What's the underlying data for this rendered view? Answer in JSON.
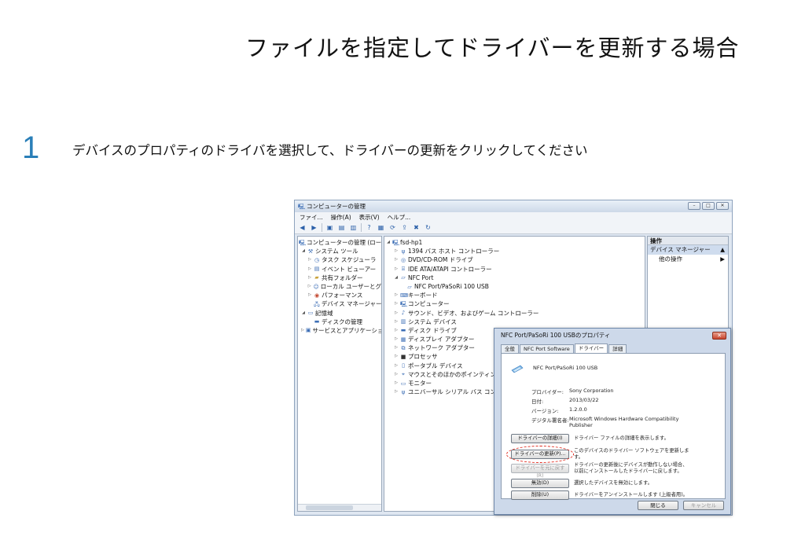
{
  "header": {
    "title": "ファイルを指定してドライバーを更新する場合"
  },
  "step": {
    "number": "1",
    "text": "デバイスのプロパティのドライバを選択して、ドライバーの更新をクリックしてください"
  },
  "cm": {
    "title": "コンピューターの管理",
    "menu": [
      "ファイ...",
      "操作(A)",
      "表示(V)",
      "ヘルプ..."
    ],
    "left_tree": [
      "コンピューターの管理 (ロー",
      "システム ツール",
      "タスク スケジューラ",
      "イベント ビューアー",
      "共有フォルダー",
      "ローカル ユーザーとグ",
      "パフォーマンス",
      "デバイス マネージャー",
      "記憶域",
      "ディスクの管理",
      "サービスとアプリケーショ"
    ],
    "mid_tree": [
      "fsd-hp1",
      "1394 バス ホスト コントローラー",
      "DVD/CD-ROM ドライブ",
      "IDE ATA/ATAPI コントローラー",
      "NFC Port",
      "NFC Port/PaSoRi 100 USB",
      "キーボード",
      "コンピューター",
      "サウンド、ビデオ、およびゲーム コントローラー",
      "システム デバイス",
      "ディスク ドライブ",
      "ディスプレイ アダプター",
      "ネットワーク アダプター",
      "プロセッサ",
      "ポータブル デバイス",
      "マウスとそのほかのポインティング",
      "モニター",
      "ユニバーサル シリアル バス コント"
    ],
    "ops": {
      "header": "操作",
      "selected": "デバイス マネージャー",
      "sub": "他の操作"
    }
  },
  "dialog": {
    "title": "NFC Port/PaSoRi 100 USBのプロパティ",
    "tabs": [
      "全般",
      "NFC Port Software",
      "ドライバー",
      "詳細"
    ],
    "device_name": "NFC Port/PaSoRi 100 USB",
    "props": [
      {
        "key": "プロバイダー:",
        "value": "Sony Corporation"
      },
      {
        "key": "日付:",
        "value": "2013/03/22"
      },
      {
        "key": "バージョン:",
        "value": "1.2.0.0"
      },
      {
        "key": "デジタル署名者:",
        "value": "Microsoft Windows Hardware Compatibility Publisher"
      }
    ],
    "actions": [
      {
        "label": "ドライバーの詳細(I)",
        "desc": "ドライバー ファイルの詳細を表示します。"
      },
      {
        "label": "ドライバーの更新(P)...",
        "desc": "このデバイスのドライバー ソフトウェアを更新します。"
      },
      {
        "label": "ドライバーを元に戻す(R)",
        "desc": "ドライバーの更新後にデバイスが動作しない場合、以前にインストールしたドライバーに戻します。"
      },
      {
        "label": "無効(D)",
        "desc": "選択したデバイスを無効にします。"
      },
      {
        "label": "削除(U)",
        "desc": "ドライバーをアンインストールします (上級者用)。"
      }
    ],
    "footer": {
      "close": "閉じる",
      "cancel": "キャンセル"
    }
  }
}
